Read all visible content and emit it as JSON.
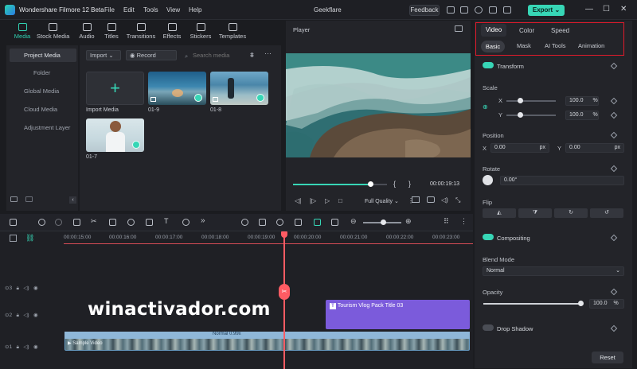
{
  "app": {
    "title": "Wondershare Filmore 12 Beta",
    "project_name": "Geekflare"
  },
  "menu": [
    "File",
    "Edit",
    "Tools",
    "View",
    "Help"
  ],
  "titlebar": {
    "feedback_label": "Feedback",
    "export_label": "Export",
    "export_color": "#37d6b6"
  },
  "toolbar": [
    {
      "label": "Media",
      "icon": "media-icon"
    },
    {
      "label": "Stock Media",
      "icon": "stock-media-icon"
    },
    {
      "label": "Audio",
      "icon": "music-note-icon"
    },
    {
      "label": "Titles",
      "icon": "text-t-icon"
    },
    {
      "label": "Transitions",
      "icon": "transition-icon"
    },
    {
      "label": "Effects",
      "icon": "sparkle-icon"
    },
    {
      "label": "Stickers",
      "icon": "sticker-icon"
    },
    {
      "label": "Templates",
      "icon": "template-icon"
    }
  ],
  "sidebar": {
    "project_media": "Project Media",
    "folder": "Folder",
    "global_media": "Global Media",
    "cloud_media": "Cloud Media",
    "adjustment_layer": "Adjustment Layer"
  },
  "media": {
    "import_dropdown": "Import",
    "record_dropdown": "Record",
    "search_placeholder": "Search media",
    "items": [
      {
        "caption": "Import Media"
      },
      {
        "caption": "01-9"
      },
      {
        "caption": "01-8"
      },
      {
        "caption": "01-7"
      }
    ]
  },
  "player": {
    "label": "Player",
    "timecode": "00:00:19:13",
    "quality": "Full Quality",
    "progress": 0.82
  },
  "right_panel": {
    "tabs": [
      "Video",
      "Color",
      "Speed"
    ],
    "active_tab": "Video",
    "subtabs": [
      "Basic",
      "Mask",
      "AI Tools",
      "Animation"
    ],
    "active_subtab": "Basic",
    "transform": "Transform",
    "scale": "Scale",
    "scale_x_label": "X",
    "scale_x": "100.0",
    "scale_y_label": "Y",
    "scale_y": "100.0",
    "percent": "%",
    "position": "Position",
    "pos_x_label": "X",
    "pos_x": "0.00",
    "pos_y_label": "Y",
    "pos_y": "0.00",
    "px": "px",
    "rotate": "Rotate",
    "rotate_value": "0.00°",
    "flip": "Flip",
    "compositing": "Compositing",
    "blend_mode": "Blend Mode",
    "blend_value": "Normal",
    "opacity": "Opacity",
    "opacity_value": "100.0",
    "drop_shadow": "Drop Shadow",
    "reset": "Reset"
  },
  "timeline": {
    "ticks": [
      "00:00:15:00",
      "00:00:16:00",
      "00:00:17:00",
      "00:00:18:00",
      "00:00:19:00",
      "00:00:20:00",
      "00:00:21:00",
      "00:00:22:00",
      "00:00:23:00"
    ],
    "tracks": [
      "3",
      "2",
      "1"
    ],
    "title_clip": "Tourism Vlog Pack Title 03",
    "video_clip": "Normal 0.99x",
    "video_clip_name": "Sample Video",
    "playhead_color": "#ff5b63",
    "title_clip_color": "#7b5bdb"
  },
  "watermark": "winactivador.com"
}
